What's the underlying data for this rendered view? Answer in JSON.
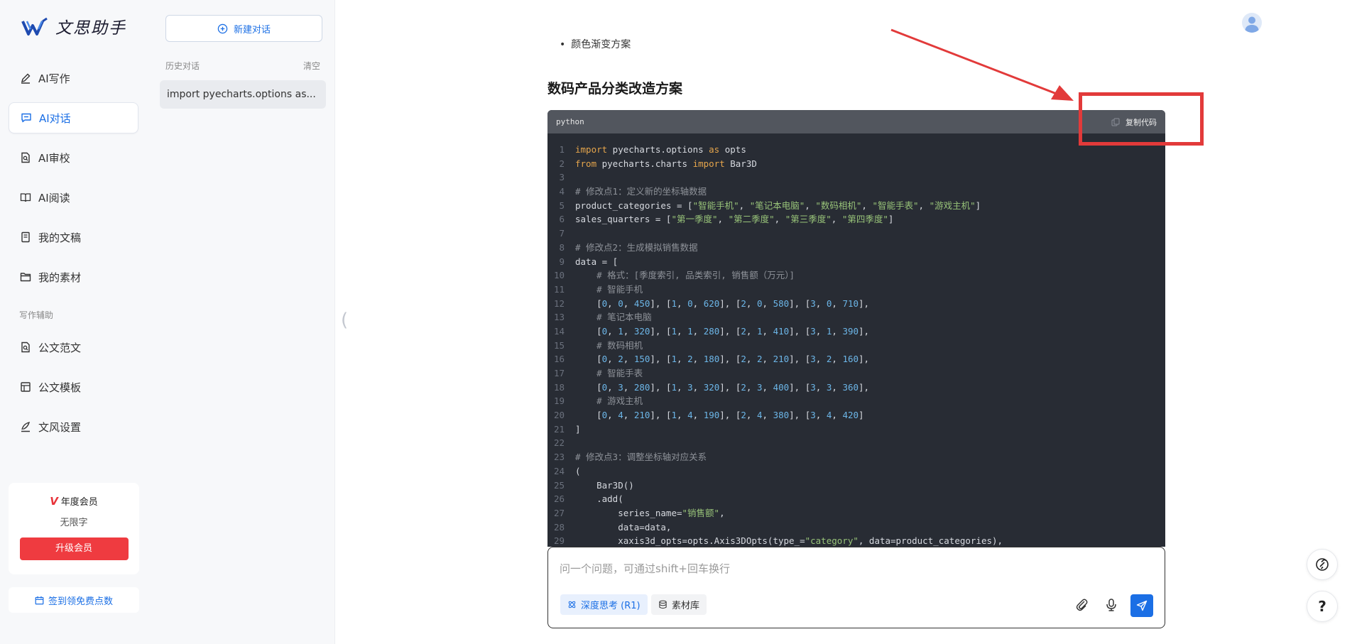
{
  "app": {
    "name": "文思助手"
  },
  "nav": {
    "items": [
      {
        "label": "AI写作",
        "icon": "pen-icon"
      },
      {
        "label": "AI对话",
        "icon": "chat-icon",
        "active": true
      },
      {
        "label": "AI审校",
        "icon": "doc-search-icon"
      },
      {
        "label": "AI阅读",
        "icon": "book-icon"
      },
      {
        "label": "我的文稿",
        "icon": "document-icon"
      },
      {
        "label": "我的素材",
        "icon": "folder-icon"
      }
    ],
    "section_label": "写作辅助",
    "assist_items": [
      {
        "label": "公文范文",
        "icon": "doc-search-icon"
      },
      {
        "label": "公文模板",
        "icon": "template-icon"
      },
      {
        "label": "文风设置",
        "icon": "style-pen-icon"
      }
    ]
  },
  "membership": {
    "title": "年度会员",
    "subtitle": "无限字",
    "upgrade_label": "升级会员"
  },
  "checkin": {
    "label": "签到领免费点数"
  },
  "history": {
    "new_chat_label": "新建对话",
    "section_label": "历史对话",
    "clear_label": "清空",
    "items": [
      {
        "title": "import pyecharts.options as..."
      }
    ]
  },
  "main": {
    "prev_bullet": "颜色渐变方案",
    "section_title": "数码产品分类改造方案",
    "code": {
      "language": "python",
      "copy_label": "复制代码",
      "lines": [
        "<span class=\"kw\">import</span> pyecharts.options <span class=\"kw\">as</span> opts",
        "<span class=\"kw\">from</span> pyecharts.charts <span class=\"kw\">import</span> Bar3D",
        "",
        "<span class=\"cm\"># 修改点1：定义新的坐标轴数据</span>",
        "product_categories = [<span class=\"str\">\"智能手机\"</span>, <span class=\"str\">\"笔记本电脑\"</span>, <span class=\"str\">\"数码相机\"</span>, <span class=\"str\">\"智能手表\"</span>, <span class=\"str\">\"游戏主机\"</span>]",
        "sales_quarters = [<span class=\"str\">\"第一季度\"</span>, <span class=\"str\">\"第二季度\"</span>, <span class=\"str\">\"第三季度\"</span>, <span class=\"str\">\"第四季度\"</span>]",
        "",
        "<span class=\"cm\"># 修改点2：生成模拟销售数据</span>",
        "data = [",
        "    <span class=\"cm\"># 格式：[季度索引, 品类索引, 销售额（万元）]</span>",
        "    <span class=\"cm\"># 智能手机</span>",
        "    [<span class=\"num\">0</span>, <span class=\"num\">0</span>, <span class=\"num\">450</span>], [<span class=\"num\">1</span>, <span class=\"num\">0</span>, <span class=\"num\">620</span>], [<span class=\"num\">2</span>, <span class=\"num\">0</span>, <span class=\"num\">580</span>], [<span class=\"num\">3</span>, <span class=\"num\">0</span>, <span class=\"num\">710</span>],",
        "    <span class=\"cm\"># 笔记本电脑</span>",
        "    [<span class=\"num\">0</span>, <span class=\"num\">1</span>, <span class=\"num\">320</span>], [<span class=\"num\">1</span>, <span class=\"num\">1</span>, <span class=\"num\">280</span>], [<span class=\"num\">2</span>, <span class=\"num\">1</span>, <span class=\"num\">410</span>], [<span class=\"num\">3</span>, <span class=\"num\">1</span>, <span class=\"num\">390</span>],",
        "    <span class=\"cm\"># 数码相机</span>",
        "    [<span class=\"num\">0</span>, <span class=\"num\">2</span>, <span class=\"num\">150</span>], [<span class=\"num\">1</span>, <span class=\"num\">2</span>, <span class=\"num\">180</span>], [<span class=\"num\">2</span>, <span class=\"num\">2</span>, <span class=\"num\">210</span>], [<span class=\"num\">3</span>, <span class=\"num\">2</span>, <span class=\"num\">160</span>],",
        "    <span class=\"cm\"># 智能手表</span>",
        "    [<span class=\"num\">0</span>, <span class=\"num\">3</span>, <span class=\"num\">280</span>], [<span class=\"num\">1</span>, <span class=\"num\">3</span>, <span class=\"num\">320</span>], [<span class=\"num\">2</span>, <span class=\"num\">3</span>, <span class=\"num\">400</span>], [<span class=\"num\">3</span>, <span class=\"num\">3</span>, <span class=\"num\">360</span>],",
        "    <span class=\"cm\"># 游戏主机</span>",
        "    [<span class=\"num\">0</span>, <span class=\"num\">4</span>, <span class=\"num\">210</span>], [<span class=\"num\">1</span>, <span class=\"num\">4</span>, <span class=\"num\">190</span>], [<span class=\"num\">2</span>, <span class=\"num\">4</span>, <span class=\"num\">380</span>], [<span class=\"num\">3</span>, <span class=\"num\">4</span>, <span class=\"num\">420</span>]",
        "]",
        "",
        "<span class=\"cm\"># 修改点3：调整坐标轴对应关系</span>",
        "(",
        "    Bar3D()",
        "    .add(",
        "        series_name=<span class=\"str\">\"销售额\"</span>,",
        "        data=data,",
        "        xaxis3d_opts=opts.Axis3DOpts(type_=<span class=\"str\">\"category\"</span>, data=product_categories),"
      ]
    }
  },
  "input": {
    "placeholder": "问一个问题，可通过shift+回车换行",
    "deep_think_label": "深度思考 (R1)",
    "library_label": "素材库"
  },
  "floating": {
    "help_label": "?"
  },
  "colors": {
    "accent": "#1b6fe5",
    "danger": "#ef3b40",
    "code_bg": "#282c34",
    "annotation": "#e23a3a"
  }
}
